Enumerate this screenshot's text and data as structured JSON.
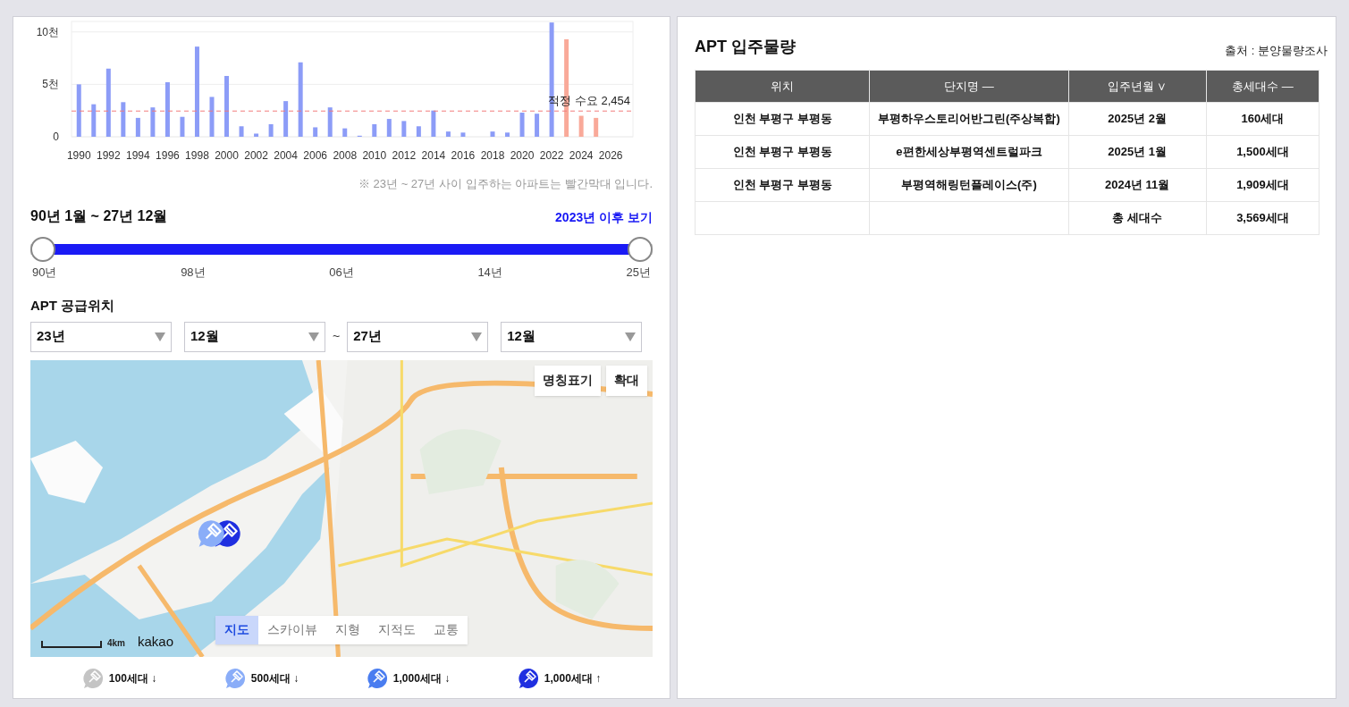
{
  "supply_chart": {
    "chart_data": {
      "type": "bar",
      "x": [
        1990,
        1991,
        1992,
        1993,
        1994,
        1995,
        1996,
        1997,
        1998,
        1999,
        2000,
        2001,
        2002,
        2003,
        2004,
        2005,
        2006,
        2007,
        2008,
        2009,
        2010,
        2011,
        2012,
        2013,
        2014,
        2015,
        2016,
        2017,
        2018,
        2019,
        2020,
        2021,
        2022,
        2023,
        2024,
        2025
      ],
      "xlim": [
        1989.5,
        2027.5
      ],
      "ylim": [
        0,
        11
      ],
      "series": [
        {
          "color": "#8c9cf7",
          "values": [
            5.0,
            3.1,
            6.5,
            3.3,
            1.8,
            2.8,
            5.2,
            1.9,
            8.6,
            3.8,
            5.8,
            1.0,
            0.3,
            1.2,
            3.4,
            7.1,
            0.9,
            2.8,
            0.8,
            0.1,
            1.2,
            1.7,
            1.5,
            1.0,
            2.5,
            0.5,
            0.4,
            0,
            0.5,
            0.4,
            2.3,
            2.2,
            10.9,
            null,
            null,
            null
          ]
        },
        {
          "color": "#f9a999",
          "values": [
            null,
            null,
            null,
            null,
            null,
            null,
            null,
            null,
            null,
            null,
            null,
            null,
            null,
            null,
            null,
            null,
            null,
            null,
            null,
            null,
            null,
            null,
            null,
            null,
            null,
            null,
            null,
            null,
            null,
            null,
            null,
            null,
            null,
            9.3,
            2.0,
            1.8
          ]
        }
      ],
      "yticks": [
        {
          "value": 0,
          "label": "0"
        },
        {
          "value": 5,
          "label": "5천"
        },
        {
          "value": 10,
          "label": "10천"
        }
      ],
      "xticks": [
        {
          "value": 1990,
          "label": "1990"
        },
        {
          "value": 1992,
          "label": "1992"
        },
        {
          "value": 1994,
          "label": "1994"
        },
        {
          "value": 1996,
          "label": "1996"
        },
        {
          "value": 1998,
          "label": "1998"
        },
        {
          "value": 2000,
          "label": "2000"
        },
        {
          "value": 2002,
          "label": "2002"
        },
        {
          "value": 2004,
          "label": "2004"
        },
        {
          "value": 2006,
          "label": "2006"
        },
        {
          "value": 2008,
          "label": "2008"
        },
        {
          "value": 2010,
          "label": "2010"
        },
        {
          "value": 2012,
          "label": "2012"
        },
        {
          "value": 2014,
          "label": "2014"
        },
        {
          "value": 2016,
          "label": "2016"
        },
        {
          "value": 2018,
          "label": "2018"
        },
        {
          "value": 2020,
          "label": "2020"
        },
        {
          "value": 2022,
          "label": "2022"
        },
        {
          "value": 2024,
          "label": "2024"
        },
        {
          "value": 2026,
          "label": "2026"
        }
      ],
      "ref_lines": [
        {
          "axis": "y",
          "value": 2.454,
          "label": "적정 수요 2,454",
          "color": "#f27c7c"
        }
      ]
    }
  },
  "chart_note": "※ 23년 ~ 27년 사이 입주하는 아파트는 빨간막대 입니다.",
  "range": {
    "title": "90년 1월 ~ 27년 12월",
    "link": "2023년 이후 보기",
    "thumbs": [
      {
        "level": 0
      },
      {
        "level": 1
      }
    ],
    "ticks": [
      "90년",
      "98년",
      "06년",
      "14년",
      "25년"
    ]
  },
  "location": {
    "title": "APT 공급위치",
    "selects": [
      {
        "value": "23년"
      },
      {
        "value": "12월"
      },
      {
        "value": "27년"
      },
      {
        "value": "12월"
      }
    ],
    "separator": "~"
  },
  "map": {
    "buttons": [
      "명칭표기",
      "확대"
    ],
    "tabs": [
      {
        "label": "지도",
        "selected": true
      },
      {
        "label": "스카이뷰",
        "selected": false
      },
      {
        "label": "지형",
        "selected": false
      },
      {
        "label": "지적도",
        "selected": false
      },
      {
        "label": "교통",
        "selected": false
      }
    ],
    "scale": "4km",
    "logo": "kakao",
    "markers": [
      {
        "color": "#8aadf8"
      },
      {
        "color": "#1f2fe0"
      }
    ]
  },
  "legend": [
    {
      "label": "100세대 ↓",
      "color": "#c4c4c4"
    },
    {
      "label": "500세대 ↓",
      "color": "#8aadf8"
    },
    {
      "label": "1,000세대 ↓",
      "color": "#4a7df0"
    },
    {
      "label": "1,000세대 ↑",
      "color": "#1f2fe0"
    }
  ],
  "occupancy": {
    "title": "APT 입주물량",
    "source": "출처 : 분양물량조사",
    "columns": [
      "위치",
      "단지명 —",
      "입주년월 ∨",
      "총세대수 —"
    ],
    "rows": [
      [
        "인천 부평구 부평동",
        "부평하우스토리어반그린(주상복합)",
        "2025년 2월",
        "160세대"
      ],
      [
        "인천 부평구 부평동",
        "e편한세상부평역센트럴파크",
        "2025년 1월",
        "1,500세대"
      ],
      [
        "인천 부평구 부평동",
        "부평역해링턴플레이스(주)",
        "2024년 11월",
        "1,909세대"
      ]
    ],
    "total": {
      "label": "총 세대수",
      "value": "3,569세대"
    }
  }
}
